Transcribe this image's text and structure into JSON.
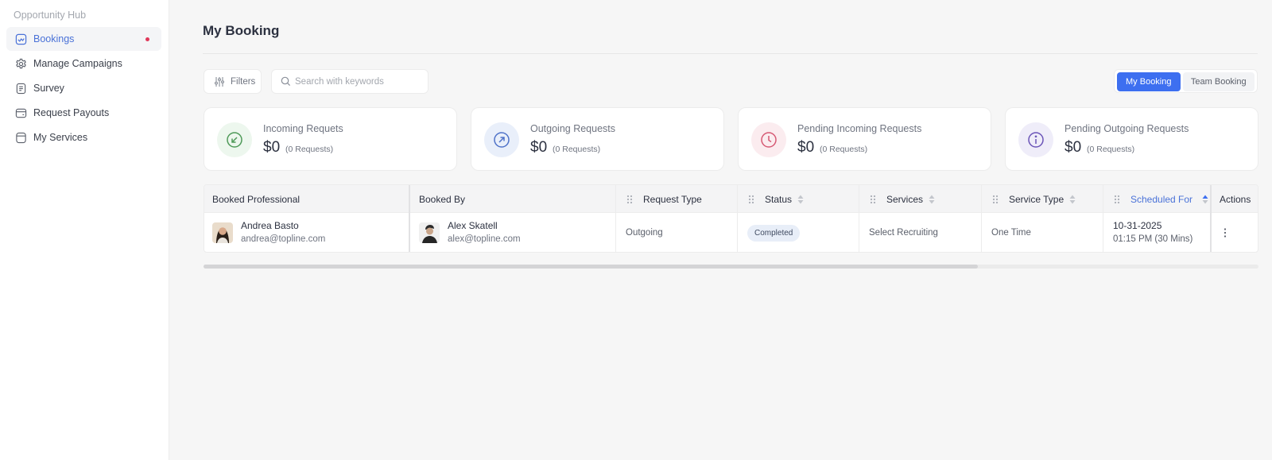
{
  "sidebar": {
    "heading": "Opportunity Hub",
    "items": [
      {
        "label": "Bookings",
        "icon": "bookings-icon",
        "active": true
      },
      {
        "label": "Manage Campaigns",
        "icon": "gear-icon"
      },
      {
        "label": "Survey",
        "icon": "survey-icon"
      },
      {
        "label": "Request Payouts",
        "icon": "payouts-icon"
      },
      {
        "label": "My Services",
        "icon": "services-icon"
      }
    ]
  },
  "page": {
    "title": "My Booking"
  },
  "toolbar": {
    "filters_label": "Filters",
    "search_placeholder": "Search with keywords",
    "toggle": {
      "my_booking": "My Booking",
      "team_booking": "Team Booking"
    }
  },
  "stats": [
    {
      "label": "Incoming Requets",
      "amount": "$0",
      "count": "(0 Requests)",
      "icon": "arrow-down-left-icon",
      "color": "#4f9a59"
    },
    {
      "label": "Outgoing Requests",
      "amount": "$0",
      "count": "(0 Requests)",
      "icon": "arrow-up-right-icon",
      "color": "#4f72c8"
    },
    {
      "label": "Pending Incoming Requests",
      "amount": "$0",
      "count": "(0 Requests)",
      "icon": "clock-icon",
      "color": "#d65a74"
    },
    {
      "label": "Pending Outgoing Requests",
      "amount": "$0",
      "count": "(0 Requests)",
      "icon": "info-icon",
      "color": "#6b55b8"
    }
  ],
  "table": {
    "columns": [
      "Booked Professional",
      "Booked By",
      "Request Type",
      "Status",
      "Services",
      "Service Type",
      "Scheduled For",
      "Actions"
    ],
    "rows": [
      {
        "professional": {
          "name": "Andrea Basto",
          "email": "andrea@topline.com"
        },
        "booked_by": {
          "name": "Alex Skatell",
          "email": "alex@topline.com"
        },
        "request_type": "Outgoing",
        "status": "Completed",
        "services": "Select Recruiting",
        "service_type": "One Time",
        "scheduled_date": "10-31-2025",
        "scheduled_time": "01:15 PM (30 Mins)"
      }
    ]
  },
  "colors": {
    "accent": "#3d6ff0",
    "active_nav": "#4a72d8",
    "dot": "#e0385a"
  }
}
